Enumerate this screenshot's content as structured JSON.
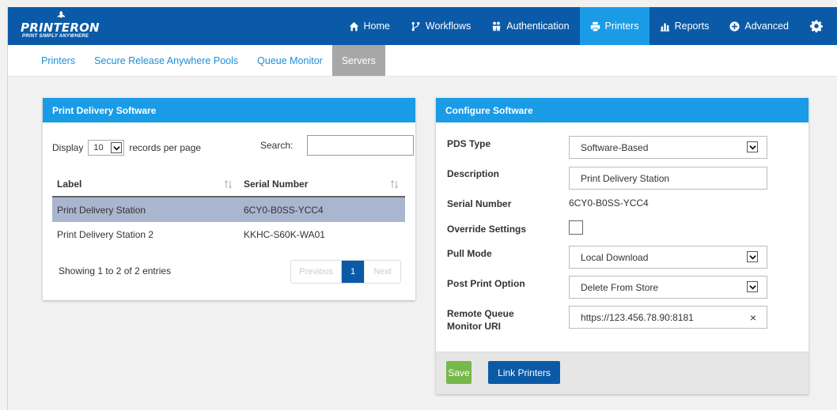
{
  "brand": {
    "name": "PRINTERON",
    "tagline": "PRINT SIMPLY ANYWHERE",
    "colors": {
      "primary": "#0b5aa7",
      "accent": "#1a9be6",
      "selected_row": "#aab5cf",
      "save": "#77b84a"
    }
  },
  "nav": {
    "items": [
      {
        "label": "Home",
        "icon": "home-icon"
      },
      {
        "label": "Workflows",
        "icon": "workflow-icon"
      },
      {
        "label": "Authentication",
        "icon": "users-icon"
      },
      {
        "label": "Printers",
        "icon": "printer-icon",
        "active": true
      },
      {
        "label": "Reports",
        "icon": "bar-chart-icon"
      },
      {
        "label": "Advanced",
        "icon": "plus-circle-icon"
      }
    ],
    "settings_icon": "gear-icon"
  },
  "subnav": {
    "items": [
      {
        "label": "Printers"
      },
      {
        "label": "Secure Release Anywhere Pools"
      },
      {
        "label": "Queue Monitor"
      },
      {
        "label": "Servers",
        "active": true
      }
    ]
  },
  "pds_panel": {
    "title": "Print Delivery Software",
    "display_label": "Display",
    "page_size": "10",
    "records_label": "records per page",
    "search_label": "Search:",
    "search_value": "",
    "columns": [
      "Label",
      "Serial Number"
    ],
    "rows": [
      {
        "label": "Print Delivery Station",
        "serial": "6CY0-B0SS-YCC4",
        "selected": true
      },
      {
        "label": "Print Delivery Station 2",
        "serial": "KKHC-S60K-WA01",
        "selected": false
      }
    ],
    "showing": "Showing 1 to 2 of 2 entries",
    "pager": {
      "previous": "Previous",
      "page": "1",
      "next": "Next"
    }
  },
  "config_panel": {
    "title": "Configure Software",
    "pds_type": {
      "label": "PDS Type",
      "value": "Software-Based"
    },
    "description": {
      "label": "Description",
      "value": "Print Delivery Station"
    },
    "serial_number": {
      "label": "Serial Number",
      "value": "6CY0-B0SS-YCC4"
    },
    "override_settings": {
      "label": "Override Settings",
      "checked": false
    },
    "pull_mode": {
      "label": "Pull Mode",
      "value": "Local Download"
    },
    "post_print": {
      "label": "Post Print Option",
      "value": "Delete From Store"
    },
    "remote_queue": {
      "label_line1": "Remote Queue",
      "label_line2": "Monitor URI",
      "value": "https://123.456.78.90:8181",
      "clear": "×"
    },
    "buttons": {
      "save": "Save",
      "link_printers": "Link Printers"
    }
  }
}
